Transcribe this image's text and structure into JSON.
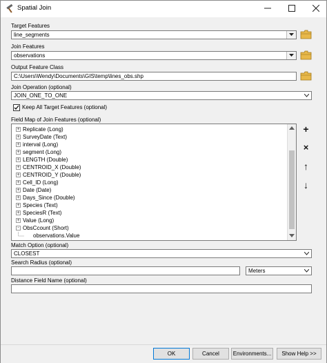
{
  "window": {
    "title": "Spatial Join",
    "minimize_icon": "minimize-icon",
    "maximize_icon": "maximize-icon",
    "close_icon": "close-icon"
  },
  "target_features": {
    "label": "Target Features",
    "value": "line_segments"
  },
  "join_features": {
    "label": "Join Features",
    "value": "observations"
  },
  "output_feature_class": {
    "label": "Output Feature Class",
    "value": "C:\\Users\\Wendy\\Documents\\GIS\\temp\\lines_obs.shp"
  },
  "join_operation": {
    "label": "Join Operation (optional)",
    "value": "JOIN_ONE_TO_ONE"
  },
  "keep_all": {
    "label": "Keep All Target Features (optional)",
    "checked": true
  },
  "field_map": {
    "label": "Field Map of Join Features (optional)",
    "items": [
      {
        "label": "Replicate (Long)",
        "expander": "+"
      },
      {
        "label": "SurveyDate (Text)",
        "expander": "+"
      },
      {
        "label": "interval (Long)",
        "expander": "+"
      },
      {
        "label": "segment (Long)",
        "expander": "+"
      },
      {
        "label": "LENGTH (Double)",
        "expander": "+"
      },
      {
        "label": "CENTROID_X (Double)",
        "expander": "+"
      },
      {
        "label": "CENTROID_Y (Double)",
        "expander": "+"
      },
      {
        "label": "Cell_ID (Long)",
        "expander": "+"
      },
      {
        "label": "Date (Date)",
        "expander": "+"
      },
      {
        "label": "Days_Since (Double)",
        "expander": "+"
      },
      {
        "label": "Species (Text)",
        "expander": "+"
      },
      {
        "label": "SpeciesR (Text)",
        "expander": "+"
      },
      {
        "label": "Value (Long)",
        "expander": "+"
      },
      {
        "label": "ObsCcount (Short)",
        "expander": "-"
      }
    ],
    "child_item": "observations.Value",
    "buttons": {
      "add": "+",
      "remove": "×",
      "up": "↑",
      "down": "↓"
    }
  },
  "match_option": {
    "label": "Match Option (optional)",
    "value": "CLOSEST"
  },
  "search_radius": {
    "label": "Search Radius (optional)",
    "value": "",
    "units": "Meters"
  },
  "distance_field": {
    "label": "Distance Field Name (optional)",
    "value": ""
  },
  "footer": {
    "ok": "OK",
    "cancel": "Cancel",
    "environments": "Environments...",
    "show_help": "Show Help >>"
  },
  "colors": {
    "accent": "#0078d7",
    "folder": "#e8b84a"
  }
}
